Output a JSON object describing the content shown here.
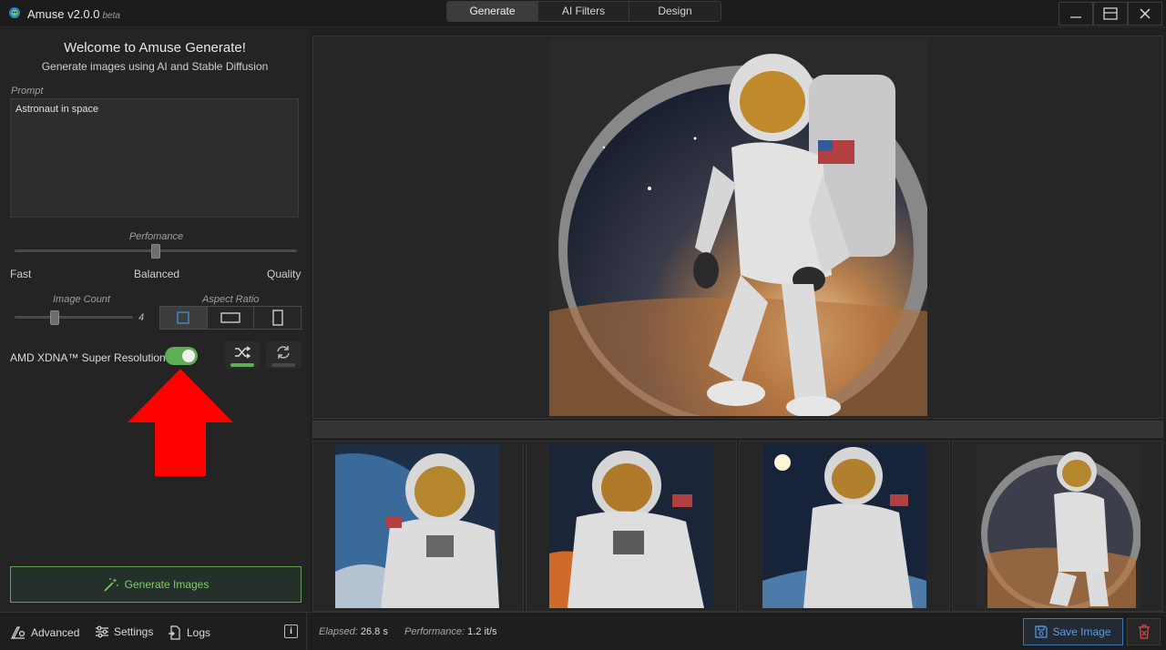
{
  "app": {
    "title": "Amuse v2.0.0",
    "beta": "beta"
  },
  "tabs": [
    {
      "label": "Generate",
      "active": true
    },
    {
      "label": "AI Filters",
      "active": false
    },
    {
      "label": "Design",
      "active": false
    }
  ],
  "window_controls": [
    "minimize-icon",
    "maximize-icon",
    "close-icon"
  ],
  "left": {
    "welcome_title": "Welcome to Amuse Generate!",
    "welcome_sub": "Generate images using AI and Stable Diffusion",
    "prompt_label": "Prompt",
    "prompt_value": "Astronaut in space",
    "performance": {
      "label": "Perfomance",
      "fast": "Fast",
      "balanced": "Balanced",
      "quality": "Quality",
      "value": "Balanced"
    },
    "image_count": {
      "label": "Image Count",
      "value": "4"
    },
    "aspect_ratio": {
      "label": "Aspect Ratio",
      "options": [
        "square",
        "landscape",
        "portrait"
      ],
      "selected": "square"
    },
    "super_resolution": {
      "label": "AMD XDNA™ Super Resolution",
      "enabled": true
    },
    "random_seed_icon": "shuffle-icon",
    "reuse_seed_icon": "refresh-icon",
    "generate_button": "Generate Images"
  },
  "status": {
    "advanced": "Advanced",
    "settings": "Settings",
    "logs": "Logs",
    "elapsed_label": "Elapsed:",
    "elapsed_value": "26.8 s",
    "performance_label": "Performance:",
    "performance_value": "1.2 it/s",
    "save_button": "Save Image"
  },
  "colors": {
    "accent_green": "#5fae55",
    "save_blue": "#3f76b8",
    "delete_red": "#e04848",
    "arrow_red": "#ff0000"
  }
}
